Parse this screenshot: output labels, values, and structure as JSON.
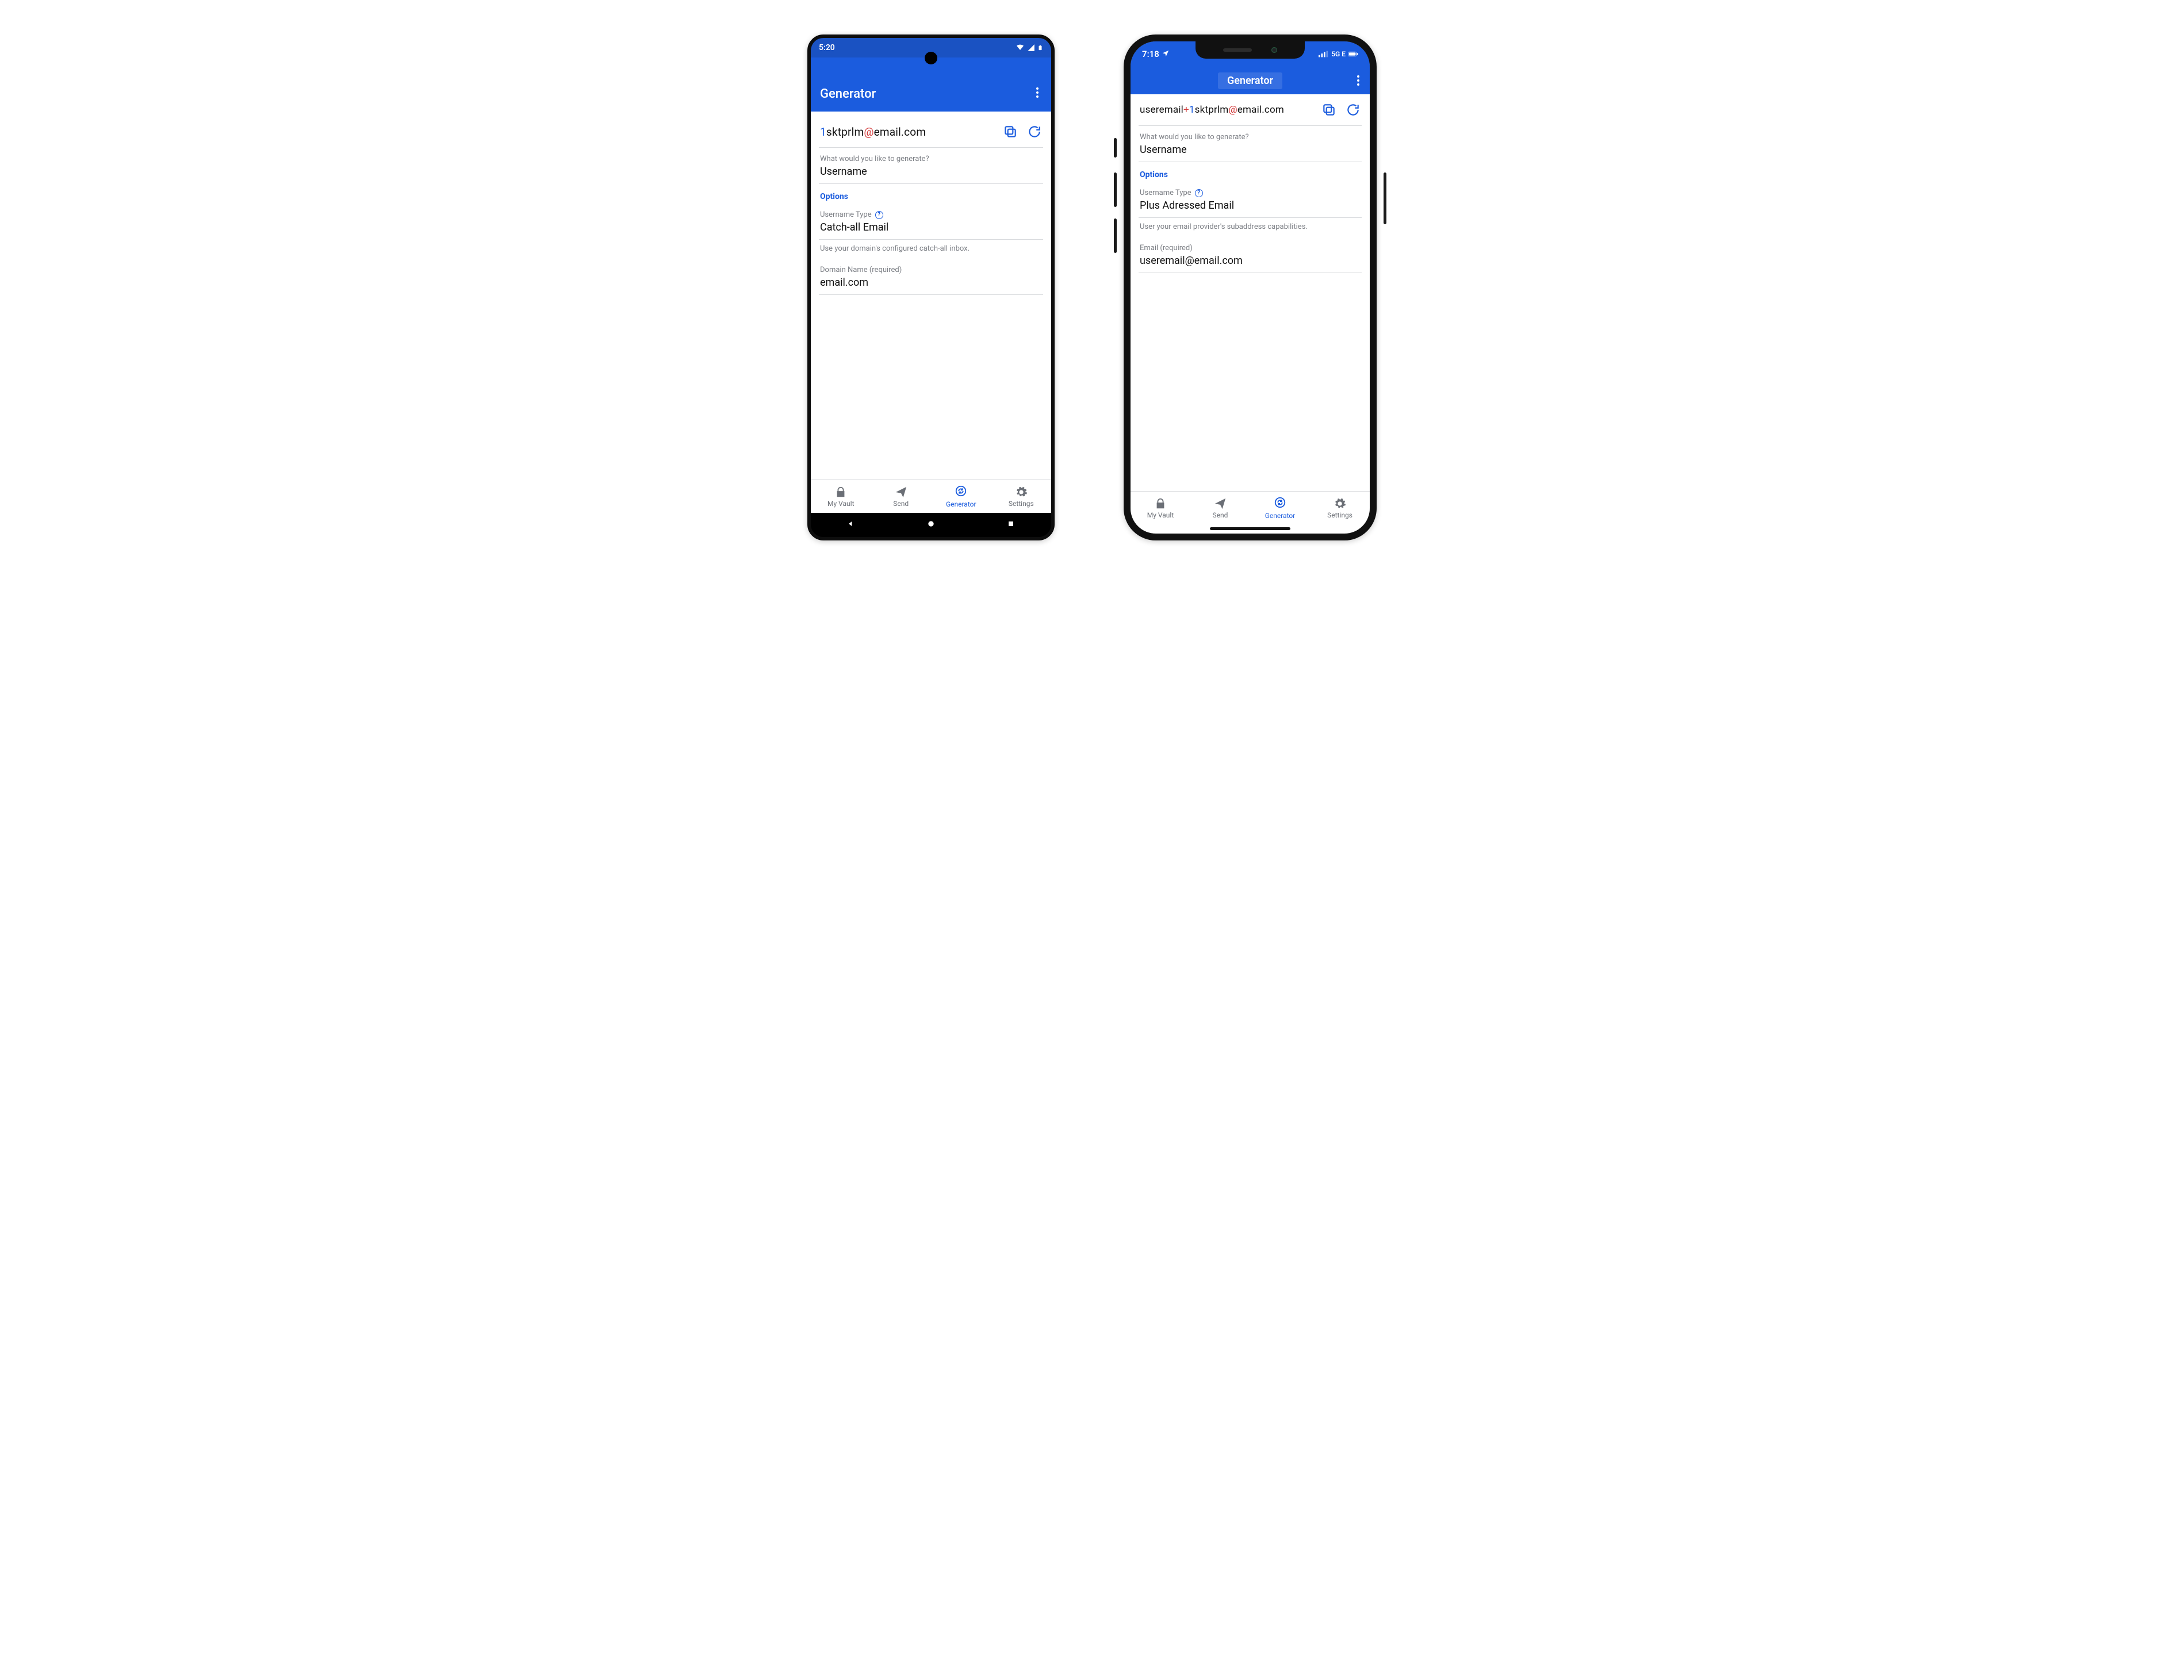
{
  "android": {
    "status_time": "5:20",
    "appbar_title": "Generator",
    "generated_parts": {
      "digit": "1",
      "body": "sktprlm",
      "at": "@",
      "domain": "email.com"
    },
    "q_label": "What would you like to generate?",
    "q_value": "Username",
    "options_header": "Options",
    "type_label": "Username Type",
    "type_value": "Catch-all Email",
    "type_helper": "Use your domain's configured catch-all inbox.",
    "input_label": "Domain Name (required)",
    "input_value": "email.com"
  },
  "ios": {
    "status_time": "7:18",
    "status_net": "5G E",
    "appbar_title": "Generator",
    "generated_parts": {
      "prefix": "useremail",
      "plus": "+",
      "digit": "1",
      "body": "sktprlm",
      "at": "@",
      "domain": "email.com"
    },
    "q_label": "What would you like to generate?",
    "q_value": "Username",
    "options_header": "Options",
    "type_label": "Username Type",
    "type_value": "Plus Adressed Email",
    "type_helper": "User your email provider's subaddress capabilities.",
    "input_label": "Email (required)",
    "input_value": "useremail@email.com"
  },
  "tabs": {
    "vault": "My Vault",
    "send": "Send",
    "generator": "Generator",
    "settings": "Settings"
  }
}
